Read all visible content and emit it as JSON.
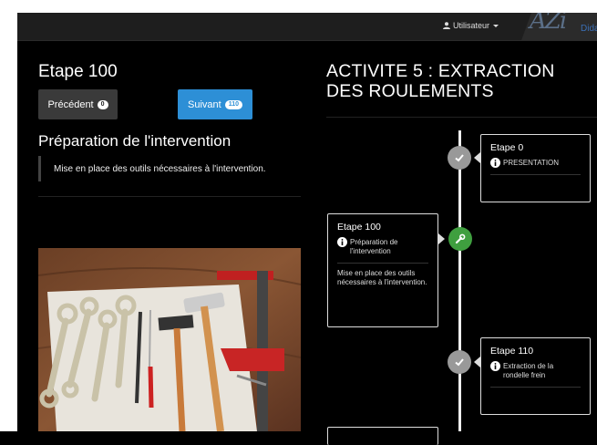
{
  "navbar": {
    "user_label": "Utilisateur",
    "logo_script": "AZi",
    "logo_text": "Dida"
  },
  "left": {
    "step_title": "Etape 100",
    "prev_button": {
      "label": "Précédent",
      "badge": "0"
    },
    "next_button": {
      "label": "Suivant",
      "badge": "110"
    },
    "section_title": "Préparation de l'intervention",
    "description": "Mise en place des outils nécessaires à l'intervention."
  },
  "right": {
    "activity_title": "ACTIVITE 5 : EXTRACTION DES ROULEMENTS",
    "timeline": [
      {
        "title": "Etape 0",
        "subtitle": "PRESENTATION",
        "icon": "check-icon",
        "status": "done"
      },
      {
        "title": "Etape 100",
        "subtitle": "Préparation de l'intervention",
        "body": "Mise en place des outils nécessaires à l'intervention.",
        "icon": "wrench-icon",
        "status": "current"
      },
      {
        "title": "Etape 110",
        "subtitle": "Extraction de la rondelle frein",
        "icon": "check-icon",
        "status": "done"
      }
    ]
  },
  "colors": {
    "primary": "#2d8fd6",
    "success": "#3f9f3f",
    "muted": "#999999",
    "background": "#000000"
  }
}
